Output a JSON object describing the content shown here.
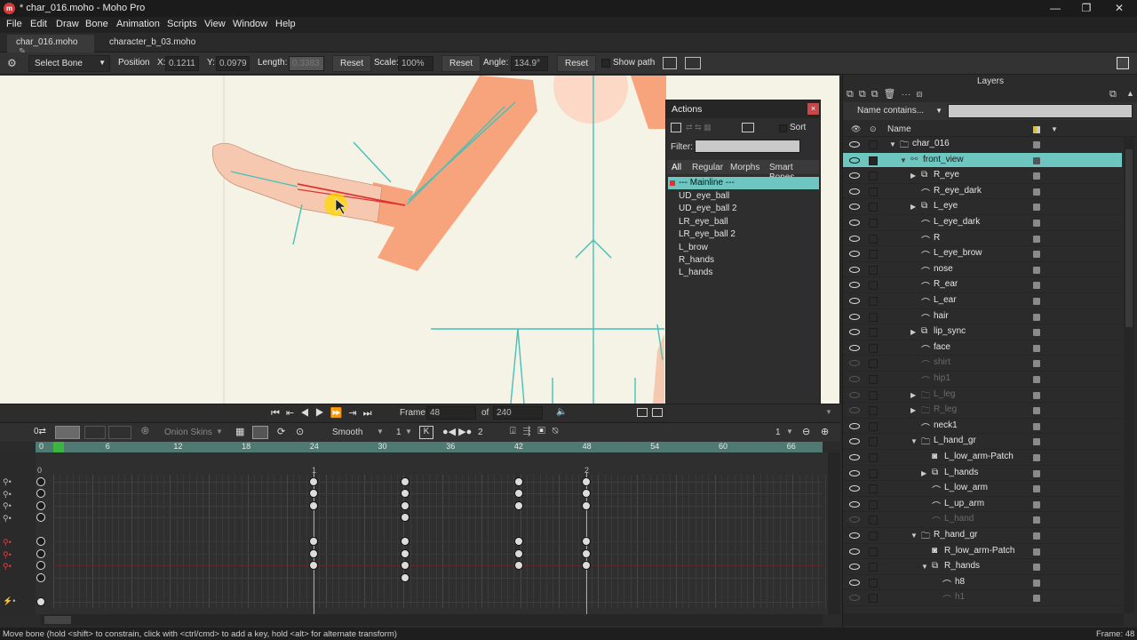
{
  "window": {
    "title": "* char_016.moho - Moho Pro",
    "app_icon": "moho-logo",
    "controls": {
      "minimize": "—",
      "maximize": "❐",
      "close": "✕"
    }
  },
  "menu": [
    "File",
    "Edit",
    "Draw",
    "Bone",
    "Animation",
    "Scripts",
    "View",
    "Window",
    "Help"
  ],
  "tabs": [
    {
      "label": "char_016.moho",
      "active": true
    },
    {
      "label": "character_b_03.moho",
      "active": false
    }
  ],
  "toolbar": {
    "tool_select": "Select Bone",
    "position_label": "Position",
    "x_label": "X:",
    "x_value": "0.1211",
    "y_label": "Y:",
    "y_value": "0.0979",
    "length_label": "Length:",
    "length_value": "0.3383",
    "reset1": "Reset",
    "scale_label": "Scale:",
    "scale_value": "100%",
    "reset2": "Reset",
    "angle_label": "Angle:",
    "angle_value": "134.9°",
    "reset3": "Reset",
    "show_path_label": "Show path"
  },
  "actions": {
    "title": "Actions",
    "sort_label": "Sort",
    "filter_label": "Filter:",
    "filter_value": "",
    "tabs": [
      "All",
      "Regular",
      "Morphs",
      "Smart Bones"
    ],
    "items": [
      "--- Mainline ---",
      "UD_eye_ball",
      "UD_eye_ball 2",
      "LR_eye_ball",
      "LR_eye_ball 2",
      "L_brow",
      "R_hands",
      "L_hands"
    ],
    "selected_index": 0
  },
  "playback": {
    "frame_label": "Frame",
    "frame_value": "48",
    "of_label": "of",
    "total_value": "240"
  },
  "timeline": {
    "onion_label": "Onion Skins",
    "interp": "Smooth",
    "interp_num": "1",
    "k_label": "K",
    "step": "2",
    "right_num": "1",
    "ruler_ticks": [
      "0",
      "6",
      "12",
      "18",
      "24",
      "30",
      "36",
      "42",
      "48",
      "54",
      "60",
      "66"
    ],
    "row_zero": "0",
    "markers": [
      "1",
      "2"
    ]
  },
  "status": {
    "message": "Move bone (hold <shift> to constrain, click with <ctrl/cmd> to add a key, hold <alt> for alternate transform)",
    "frame": "Frame: 48"
  },
  "layers_panel": {
    "title": "Layers",
    "search_mode": "Name contains...",
    "search_value": "",
    "col_name": "Name",
    "rows": [
      {
        "name": "char_016",
        "indent": 1,
        "icon": "folder",
        "tri": "▼",
        "dim": false
      },
      {
        "name": "front_view",
        "indent": 2,
        "icon": "bone",
        "tri": "▼",
        "dim": false,
        "selected": true
      },
      {
        "name": "R_eye",
        "indent": 3,
        "icon": "switch",
        "tri": "▶",
        "dim": false
      },
      {
        "name": "R_eye_dark",
        "indent": 3,
        "icon": "vector",
        "tri": "",
        "dim": false
      },
      {
        "name": "L_eye",
        "indent": 3,
        "icon": "switch",
        "tri": "▶",
        "dim": false
      },
      {
        "name": "L_eye_dark",
        "indent": 3,
        "icon": "vector",
        "tri": "",
        "dim": false
      },
      {
        "name": "R",
        "indent": 3,
        "icon": "vector",
        "tri": "",
        "dim": false
      },
      {
        "name": "L_eye_brow",
        "indent": 3,
        "icon": "vector",
        "tri": "",
        "dim": false
      },
      {
        "name": "nose",
        "indent": 3,
        "icon": "vector",
        "tri": "",
        "dim": false
      },
      {
        "name": "R_ear",
        "indent": 3,
        "icon": "vector",
        "tri": "",
        "dim": false
      },
      {
        "name": "L_ear",
        "indent": 3,
        "icon": "vector",
        "tri": "",
        "dim": false
      },
      {
        "name": "hair",
        "indent": 3,
        "icon": "vector",
        "tri": "",
        "dim": false
      },
      {
        "name": "lip_sync",
        "indent": 3,
        "icon": "switch",
        "tri": "▶",
        "dim": false
      },
      {
        "name": "face",
        "indent": 3,
        "icon": "vector",
        "tri": "",
        "dim": false
      },
      {
        "name": "shirt",
        "indent": 3,
        "icon": "vector",
        "tri": "",
        "dim": true
      },
      {
        "name": "hip1",
        "indent": 3,
        "icon": "vector",
        "tri": "",
        "dim": true
      },
      {
        "name": "L_leg",
        "indent": 3,
        "icon": "folder",
        "tri": "▶",
        "dim": true
      },
      {
        "name": "R_leg",
        "indent": 3,
        "icon": "folder",
        "tri": "▶",
        "dim": true
      },
      {
        "name": "neck1",
        "indent": 3,
        "icon": "vector",
        "tri": "",
        "dim": false
      },
      {
        "name": "L_hand_gr",
        "indent": 3,
        "icon": "folder",
        "tri": "▼",
        "dim": false
      },
      {
        "name": "L_low_arm-Patch",
        "indent": 4,
        "icon": "patch",
        "tri": "",
        "dim": false
      },
      {
        "name": "L_hands",
        "indent": 4,
        "icon": "switch",
        "tri": "▶",
        "dim": false
      },
      {
        "name": "L_low_arm",
        "indent": 4,
        "icon": "vector",
        "tri": "",
        "dim": false
      },
      {
        "name": "L_up_arm",
        "indent": 4,
        "icon": "vector",
        "tri": "",
        "dim": false
      },
      {
        "name": "L_hand",
        "indent": 4,
        "icon": "vector",
        "tri": "",
        "dim": true
      },
      {
        "name": "R_hand_gr",
        "indent": 3,
        "icon": "folder",
        "tri": "▼",
        "dim": false
      },
      {
        "name": "R_low_arm-Patch",
        "indent": 4,
        "icon": "patch",
        "tri": "",
        "dim": false
      },
      {
        "name": "R_hands",
        "indent": 4,
        "icon": "switch",
        "tri": "▼",
        "dim": false
      },
      {
        "name": "h8",
        "indent": 5,
        "icon": "vector",
        "tri": "",
        "dim": false
      },
      {
        "name": "h1",
        "indent": 5,
        "icon": "vector",
        "tri": "",
        "dim": true
      }
    ]
  },
  "colors": {
    "accent_teal": "#6ec6c0",
    "bone": "#45c1b8",
    "skin": "#f7a47c",
    "canvas_bg": "#f5f2e6",
    "selected_bone": "#d33"
  }
}
